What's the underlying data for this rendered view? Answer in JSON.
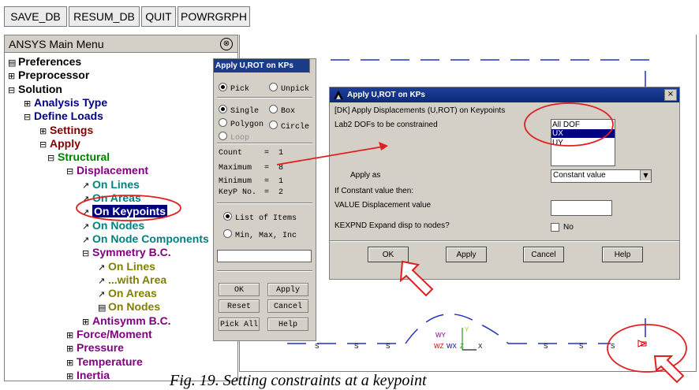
{
  "toolbar": {
    "buttons": [
      "SAVE_DB",
      "RESUM_DB",
      "QUIT",
      "POWRGRPH"
    ]
  },
  "main_menu": {
    "title": "ANSYS Main Menu",
    "collapse_icon": "⊗",
    "items": [
      {
        "label": "Preferences",
        "marker": "▤"
      },
      {
        "label": "Preprocessor",
        "marker": "⊞"
      },
      {
        "label": "Solution",
        "marker": "⊟"
      },
      {
        "label": "Analysis Type",
        "marker": "⊞"
      },
      {
        "label": "Define Loads",
        "marker": "⊟"
      },
      {
        "label": "Settings",
        "marker": "⊞"
      },
      {
        "label": "Apply",
        "marker": "⊟"
      },
      {
        "label": "Structural",
        "marker": "⊟"
      },
      {
        "label": "Displacement",
        "marker": "⊟"
      },
      {
        "label": "On Lines",
        "marker": "↗"
      },
      {
        "label": "On Areas",
        "marker": "↗"
      },
      {
        "label": "On Keypoints",
        "marker": "↗"
      },
      {
        "label": "On Nodes",
        "marker": "↗"
      },
      {
        "label": "On Node Components",
        "marker": "↗"
      },
      {
        "label": "Symmetry B.C.",
        "marker": "⊟"
      },
      {
        "label": "On Lines",
        "marker": "↗"
      },
      {
        "label": "...with Area",
        "marker": "↗"
      },
      {
        "label": "On Areas",
        "marker": "↗"
      },
      {
        "label": "On Nodes",
        "marker": "▤"
      },
      {
        "label": "Antisymm B.C.",
        "marker": "⊞"
      },
      {
        "label": "Force/Moment",
        "marker": "⊞"
      },
      {
        "label": "Pressure",
        "marker": "⊞"
      },
      {
        "label": "Temperature",
        "marker": "⊞"
      },
      {
        "label": "Inertia",
        "marker": "⊞"
      }
    ]
  },
  "pick_panel": {
    "title": "Apply U,ROT on KPs",
    "pick": "Pick",
    "unpick": "Unpick",
    "single": "Single",
    "box": "Box",
    "polygon": "Polygon",
    "circle": "Circle",
    "loop": "Loop",
    "count_label": "Count",
    "count_value": "1",
    "maximum_label": "Maximum",
    "maximum_value": "8",
    "minimum_label": "Minimum",
    "minimum_value": "1",
    "keyp_label": "KeyP No.",
    "keyp_value": "2",
    "eq": "=",
    "list_of_items": "List of Items",
    "min_max_inc": "Min, Max, Inc",
    "ok": "OK",
    "apply": "Apply",
    "reset": "Reset",
    "cancel": "Cancel",
    "pick_all": "Pick All",
    "help": "Help"
  },
  "dialog": {
    "title": "Apply U,ROT on KPs",
    "close": "×",
    "heading": "[DK]  Apply Displacements (U,ROT) on Keypoints",
    "lab2": "Lab2    DOFs to be constrained",
    "dof_options": [
      "All DOF",
      "UX",
      "UY"
    ],
    "apply_as_label": "Apply as",
    "apply_as_value": "Constant value",
    "if_constant": "If Constant value then:",
    "value_label": "VALUE   Displacement value",
    "kexpnd_label": "KEXPND  Expand disp to nodes?",
    "kexpnd_value": "No",
    "ok": "OK",
    "apply": "Apply",
    "cancel": "Cancel",
    "help": "Help"
  },
  "graphics": {
    "labels": {
      "s": "S",
      "wy": "WY",
      "y": "Y",
      "wz": "WZ",
      "wx": "WX",
      "z": "Z",
      "x": "X"
    }
  },
  "caption": "Fig. 19. Setting constraints at a keypoint",
  "colors": {
    "selection": "#000080",
    "annotation_red": "#e02020",
    "line_blue": "#2030c0",
    "title_bar": "#1a3a8a"
  }
}
